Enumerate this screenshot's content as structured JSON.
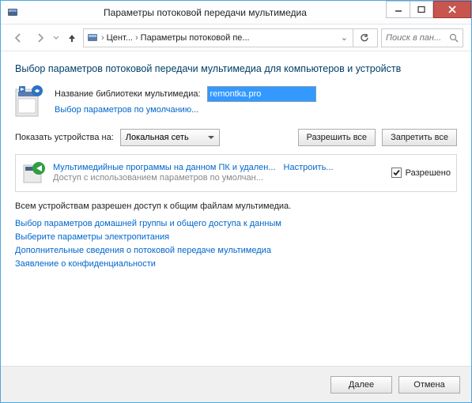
{
  "window": {
    "title": "Параметры потоковой передачи мультимедиа",
    "breadcrumb": {
      "seg1": "Цент...",
      "seg2": "Параметры потоковой пе..."
    },
    "search_placeholder": "Поиск в пан..."
  },
  "heading": "Выбор параметров потоковой передачи мультимедиа для компьютеров и устройств",
  "library": {
    "label": "Название библиотеки мультимедиа:",
    "value": "remontka.pro",
    "defaults_link": "Выбор параметров по умолчанию..."
  },
  "show": {
    "label": "Показать устройства на:",
    "selected": "Локальная сеть",
    "allow_all": "Разрешить все",
    "block_all": "Запретить все"
  },
  "device": {
    "title": "Мультимедийные программы на данном ПК и удален...",
    "configure": "Настроить...",
    "subtitle": "Доступ с использованием параметров по умолчан...",
    "checked": true,
    "allowed_label": "Разрешено"
  },
  "status": "Всем устройствам разрешен доступ к общим файлам мультимедиа.",
  "links": {
    "l1": "Выбор параметров домашней группы и общего доступа к данным",
    "l2": "Выберите параметры электропитания",
    "l3": "Дополнительные сведения о потоковой передаче мультимедиа",
    "l4": "Заявление о конфиденциальности"
  },
  "footer": {
    "next": "Далее",
    "cancel": "Отмена"
  }
}
